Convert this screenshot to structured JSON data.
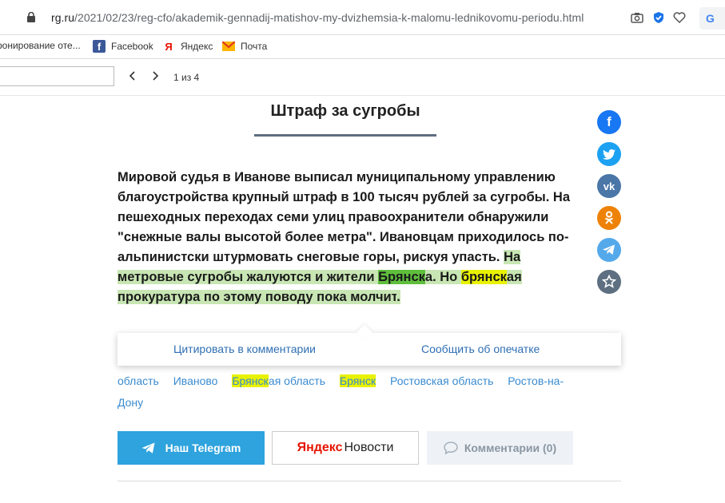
{
  "browser": {
    "url_host": "rg.ru",
    "url_path": "/2021/02/23/reg-cfo/akademik-gennadij-matishov-my-dvizhemsia-k-malomu-lednikovomu-periodu.html",
    "toolbar_icons": [
      "camera-icon",
      "shield-check-icon",
      "heart-icon"
    ],
    "google_button": "G"
  },
  "bookmarks": [
    {
      "label": "ронирование оте...",
      "icon": "hotel-icon"
    },
    {
      "label": "Facebook",
      "icon": "facebook-icon"
    },
    {
      "label": "Яндекс",
      "icon": "yandex-icon"
    },
    {
      "label": "Почта",
      "icon": "mail-icon"
    }
  ],
  "find": {
    "value": "",
    "count": "1 из 4"
  },
  "article": {
    "title": "Штраф за сугробы",
    "p1": "Мировой судья в Иванове выписал муниципальному управлению благоустройства крупный штраф в 100 тысяч рублей за сугробы. На пешеходных переходах семи улиц правоохранители обнаружили \"снежные валы высотой более метра\". Ивановцам приходилось по-альпинистски штурмовать снеговые горы, рискуя упасть.",
    "sel1": "На метровые сугробы жалуются и жители ",
    "match1": "Брянск",
    "sel2": "а. Но ",
    "match2": "брянск",
    "sel3": "ая прокуратура по этому поводу пока молчит",
    "end": "."
  },
  "popup": {
    "quote": "Цитировать в комментарии",
    "typo": "Сообщить об опечатке"
  },
  "tags": {
    "t1": "область",
    "t2": "Иваново",
    "t3_match": "Брянск",
    "t3_rest": "ая область",
    "t4_match": "Брянск",
    "t5": "Ростовская область",
    "t6": "Ростов-на-Дону"
  },
  "buttons": {
    "telegram": "Наш Telegram",
    "yandex_logo": "Яндекс",
    "yandex_news": "Новости",
    "comments": "Комментарии (0)"
  },
  "colors": {
    "telegram": "#2ea3dd",
    "facebook": "#1877f2",
    "twitter": "#1da1f2",
    "vk": "#4a76a8",
    "ok": "#ee8208",
    "telegram_share": "#54a9eb",
    "star": "#5d6f80"
  }
}
